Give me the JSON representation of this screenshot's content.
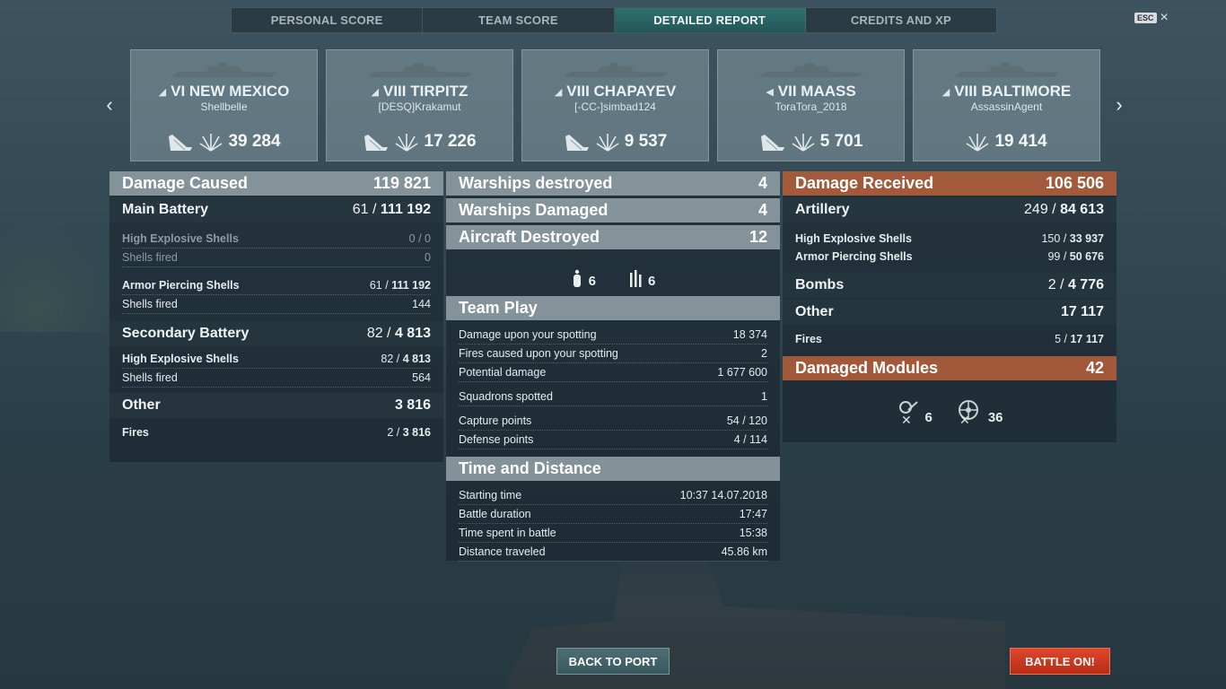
{
  "tabs": [
    "PERSONAL SCORE",
    "TEAM SCORE",
    "DETAILED REPORT",
    "CREDITS AND XP"
  ],
  "esc": {
    "key": "ESC",
    "close": "×"
  },
  "cards": [
    {
      "name": "VI NEW MEXICO",
      "player": "Shellbelle",
      "damage": "39 284"
    },
    {
      "name": "VIII TIRPITZ",
      "player": "[DESQ]Krakamut",
      "damage": "17 226"
    },
    {
      "name": "VIII CHAPAYEV",
      "player": "[-CC-]simbad124",
      "damage": "9 537"
    },
    {
      "name": "VII MAASS",
      "player": "ToraTora_2018",
      "damage": "5 701"
    },
    {
      "name": "VIII BALTIMORE",
      "player": "AssassinAgent",
      "damage": "19 414"
    }
  ],
  "left": {
    "damage_caused": {
      "label": "Damage Caused",
      "value": "119 821"
    },
    "main_battery": {
      "label": "Main Battery",
      "hits": "61",
      "value": "111 192"
    },
    "mb_he": {
      "label": "High Explosive Shells",
      "hits": "0",
      "value": "0"
    },
    "mb_he_fired": {
      "label": "Shells fired",
      "value": "0"
    },
    "mb_ap": {
      "label": "Armor Piercing Shells",
      "hits": "61",
      "value": "111 192"
    },
    "mb_ap_fired": {
      "label": "Shells fired",
      "value": "144"
    },
    "secondary": {
      "label": "Secondary Battery",
      "hits": "82",
      "value": "4 813"
    },
    "sec_he": {
      "label": "High Explosive Shells",
      "hits": "82",
      "value": "4 813"
    },
    "sec_he_fired": {
      "label": "Shells fired",
      "value": "564"
    },
    "other": {
      "label": "Other",
      "value": "3 816"
    },
    "fires": {
      "label": "Fires",
      "hits": "2",
      "value": "3 816"
    }
  },
  "middle": {
    "warships_destroyed": {
      "label": "Warships destroyed",
      "value": "4"
    },
    "warships_damaged": {
      "label": "Warships Damaged",
      "value": "4"
    },
    "aircraft_destroyed": {
      "label": "Aircraft Destroyed",
      "value": "12"
    },
    "aircraft_icons": [
      {
        "icon": "plane-icon",
        "value": "6"
      },
      {
        "icon": "squadron-icon",
        "value": "6"
      }
    ],
    "team_play": {
      "title": "Team Play",
      "rows": [
        {
          "label": "Damage upon your spotting",
          "value": "18 374"
        },
        {
          "label": "Fires caused upon your spotting",
          "value": "2"
        },
        {
          "label": "Potential damage",
          "value": "1 677 600"
        },
        {
          "label": "Squadrons spotted",
          "value": "1"
        },
        {
          "label": "Capture points",
          "value": "54 / 120"
        },
        {
          "label": "Defense points",
          "value": "4 / 114"
        }
      ]
    },
    "time_distance": {
      "title": "Time and Distance",
      "rows": [
        {
          "label": "Starting time",
          "value": "10:37  14.07.2018"
        },
        {
          "label": "Battle duration",
          "value": "17:47"
        },
        {
          "label": "Time spent in battle",
          "value": "15:38"
        },
        {
          "label": "Distance traveled",
          "value": "45.86 km"
        }
      ]
    }
  },
  "right": {
    "damage_received": {
      "label": "Damage Received",
      "value": "106 506"
    },
    "artillery": {
      "label": "Artillery",
      "hits": "249",
      "value": "84 613"
    },
    "art_he": {
      "label": "High Explosive Shells",
      "hits": "150",
      "value": "33 937"
    },
    "art_ap": {
      "label": "Armor Piercing Shells",
      "hits": "99",
      "value": "50 676"
    },
    "bombs": {
      "label": "Bombs",
      "hits": "2",
      "value": "4 776"
    },
    "other": {
      "label": "Other",
      "value": "17 117"
    },
    "fires": {
      "label": "Fires",
      "hits": "5",
      "value": "17 117"
    },
    "damaged_modules": {
      "label": "Damaged Modules",
      "value": "42"
    },
    "module_icons": [
      {
        "icon": "turret-icon",
        "value": "6"
      },
      {
        "icon": "steering-icon",
        "value": "36"
      }
    ]
  },
  "buttons": {
    "back": "BACK TO PORT",
    "battle": "BATTLE ON!"
  }
}
